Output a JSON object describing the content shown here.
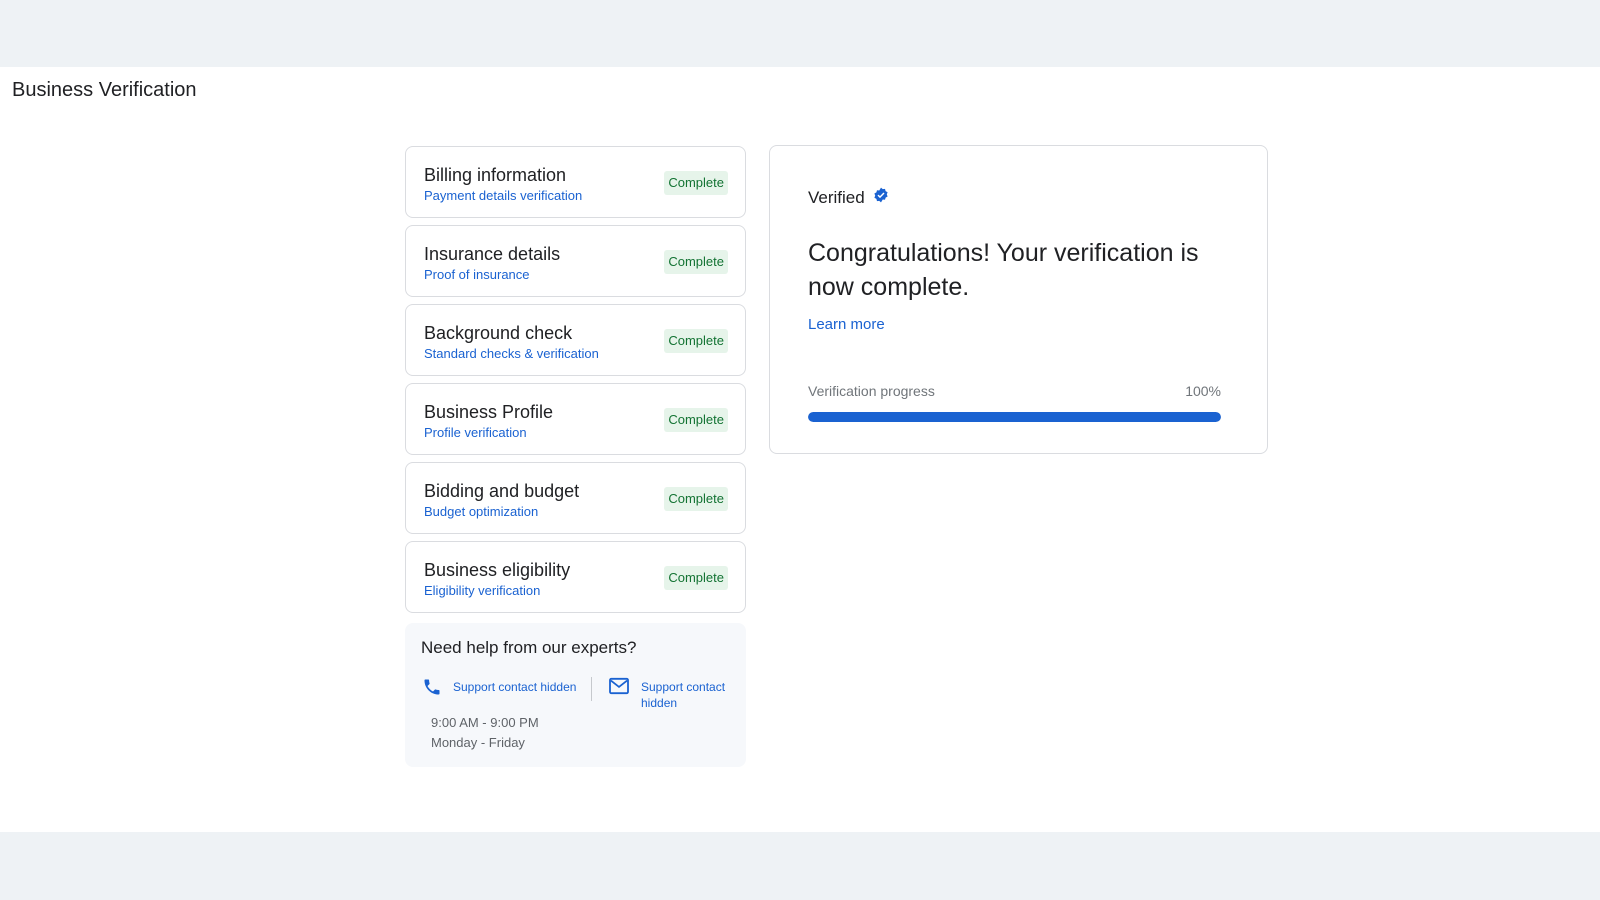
{
  "page": {
    "title": "Business Verification"
  },
  "steps": [
    {
      "title": "Billing information",
      "subtitle": "Payment details verification",
      "status": "Complete"
    },
    {
      "title": "Insurance details",
      "subtitle": "Proof of insurance",
      "status": "Complete"
    },
    {
      "title": "Background check",
      "subtitle": "Standard checks & verification",
      "status": "Complete"
    },
    {
      "title": "Business Profile",
      "subtitle": "Profile verification",
      "status": "Complete"
    },
    {
      "title": "Bidding and budget",
      "subtitle": "Budget optimization",
      "status": "Complete"
    },
    {
      "title": "Business eligibility",
      "subtitle": "Eligibility verification",
      "status": "Complete"
    }
  ],
  "help": {
    "title": "Need help from our experts?",
    "phone_label": "Support contact hidden",
    "email_label": "Support contact hidden",
    "hours": "9:00 AM - 9:00 PM",
    "days": "Monday - Friday",
    "icons": {
      "phone": "phone-icon",
      "email": "mail-icon"
    }
  },
  "verification": {
    "status_label": "Verified",
    "status_icon": "verified-badge-icon",
    "message": "Congratulations! Your verification is now complete.",
    "learn_more": "Learn more",
    "progress_label": "Verification progress",
    "progress_text": "100%",
    "progress_value": 100
  },
  "colors": {
    "accent": "#1a62d1",
    "complete_bg": "#e6f4ea",
    "complete_text": "#137333"
  }
}
